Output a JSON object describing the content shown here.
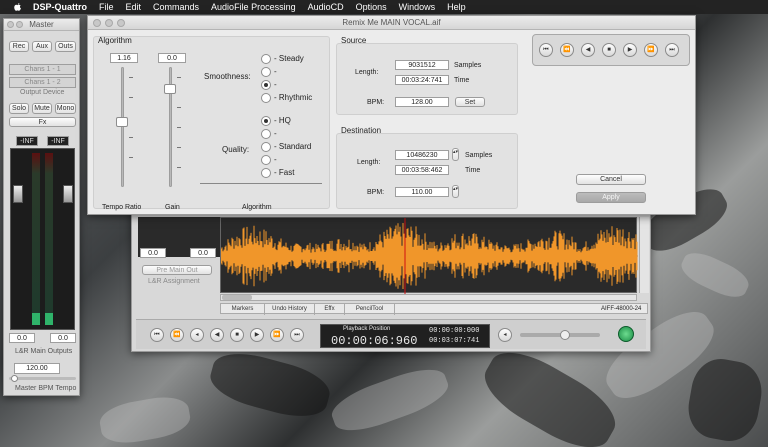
{
  "menubar": {
    "apple_icon": "apple-icon",
    "items": [
      "DSP-Quattro",
      "File",
      "Edit",
      "Commands",
      "AudioFile Processing",
      "AudioCD",
      "Options",
      "Windows",
      "Help"
    ]
  },
  "master": {
    "title": "Master",
    "buttons": [
      "Rec",
      "Aux",
      "Outs"
    ],
    "channel_fields": [
      "Chans 1 - 1",
      "Chans 1 - 2"
    ],
    "output_device_label": "Output Device",
    "mode_buttons": [
      "Solo",
      "Mute",
      "Mono"
    ],
    "fx_button": "Fx",
    "peak_left": "-INF",
    "peak_right": "-INF",
    "meter_value_left": "0.0",
    "meter_value_right": "0.0",
    "outputs_label": "L&R Main Outputs",
    "tempo_value": "120.00",
    "tempo_label": "Master BPM Tempo"
  },
  "remix": {
    "title": "Remix Me MAIN VOCAL.aif",
    "algorithm_group": "Algorithm",
    "tempo_ratio_value": "1.16",
    "tempo_ratio_label": "Tempo Ratio",
    "gain_value": "0.0",
    "gain_label": "Gain",
    "smoothness_label": "Smoothness:",
    "smoothness_options": [
      "- Steady",
      "-",
      "-",
      "- Rhythmic"
    ],
    "smoothness_selected": 2,
    "quality_label": "Quality:",
    "quality_options": [
      "- HQ",
      "-",
      "- Standard",
      "-",
      "- Fast"
    ],
    "quality_selected": 0,
    "algorithm_caption": "Algorithm",
    "source_group": "Source",
    "source_length_label": "Length:",
    "source_samples": "9031512",
    "source_samples_unit": "Samples",
    "source_time": "00:03:24:741",
    "source_time_unit": "Time",
    "source_bpm_label": "BPM:",
    "source_bpm": "128.00",
    "set_button": "Set",
    "dest_group": "Destination",
    "dest_length_label": "Length:",
    "dest_samples": "10486230",
    "dest_samples_unit": "Samples",
    "dest_time": "00:03:58:462",
    "dest_time_unit": "Time",
    "dest_bpm_label": "BPM:",
    "dest_bpm": "110.00",
    "cancel_button": "Cancel",
    "apply_button": "Apply",
    "transport_icons": [
      "rewind-start-icon",
      "rewind-icon",
      "step-back-icon",
      "stop-icon",
      "play-icon",
      "fast-forward-icon",
      "skip-end-icon"
    ]
  },
  "editor": {
    "level_left": "0.0",
    "level_right": "0.0",
    "fx_dropdown": "Pre Main Out",
    "outputs_label": "L&R Assignment",
    "tabs": [
      "Markers",
      "Undo History",
      "Effx",
      "PencilTool"
    ],
    "format_label": "AIFF-48000-24",
    "playback_label": "Playback Position",
    "playback_time": "00:00:06:960",
    "start_time": "00:00:00:000",
    "end_time": "00:03:07:741",
    "waveform_color": "#f0962a",
    "playhead_color": "#d01010"
  },
  "colors": {
    "accent": "#f0962a",
    "meter_green": "#2fb36a"
  }
}
